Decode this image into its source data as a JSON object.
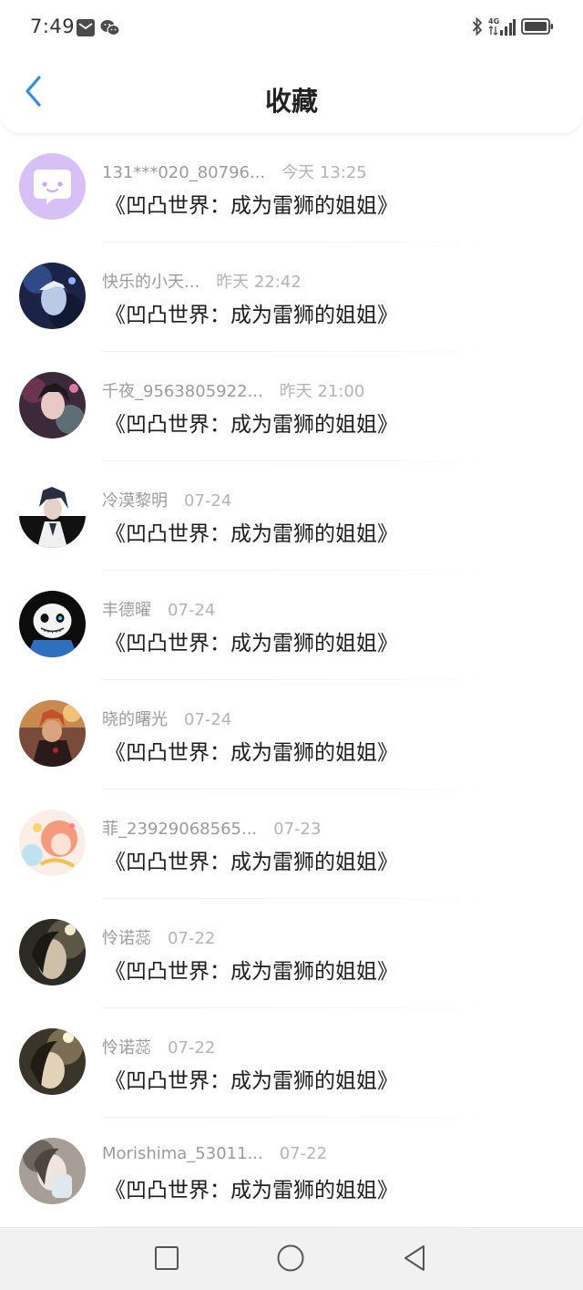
{
  "status_bar": {
    "time": "7:49",
    "left_icons": [
      "mail-icon",
      "wechat-icon"
    ],
    "right_icons": [
      "bluetooth-icon",
      "signal-4g-icon",
      "battery-icon"
    ],
    "network": "4G"
  },
  "header": {
    "title": "收藏",
    "back_icon": "chevron-left-icon",
    "accent_color": "#2b8ee8"
  },
  "items": [
    {
      "name": "131***020_80796...",
      "time": "今天 13:25",
      "title": "《凹凸世界：成为雷狮的姐姐》",
      "avatar": "chat-bubble-avatar"
    },
    {
      "name": "快乐的小天...",
      "time": "昨天 22:42",
      "title": "《凹凸世界：成为雷狮的姐姐》",
      "avatar": "user-avatar"
    },
    {
      "name": "千夜_9563805922...",
      "time": "昨天 21:00",
      "title": "《凹凸世界：成为雷狮的姐姐》",
      "avatar": "user-avatar"
    },
    {
      "name": "冷漠黎明",
      "time": "07-24",
      "title": "《凹凸世界：成为雷狮的姐姐》",
      "avatar": "user-avatar"
    },
    {
      "name": "丰德曜",
      "time": "07-24",
      "title": "《凹凸世界：成为雷狮的姐姐》",
      "avatar": "user-avatar"
    },
    {
      "name": "晓的曙光",
      "time": "07-24",
      "title": "《凹凸世界：成为雷狮的姐姐》",
      "avatar": "user-avatar"
    },
    {
      "name": "菲_23929068565...",
      "time": "07-23",
      "title": "《凹凸世界：成为雷狮的姐姐》",
      "avatar": "user-avatar"
    },
    {
      "name": "怜诺蕊",
      "time": "07-22",
      "title": "《凹凸世界：成为雷狮的姐姐》",
      "avatar": "user-avatar"
    },
    {
      "name": "怜诺蕊",
      "time": "07-22",
      "title": "《凹凸世界：成为雷狮的姐姐》",
      "avatar": "user-avatar"
    },
    {
      "name": "Morishima_53011...",
      "time": "07-22",
      "title": "《凹凸世界：成为雷狮的姐姐》",
      "avatar": "user-avatar"
    }
  ],
  "nav_bar": {
    "buttons": [
      "square-recents-icon",
      "circle-home-icon",
      "triangle-back-icon"
    ]
  }
}
